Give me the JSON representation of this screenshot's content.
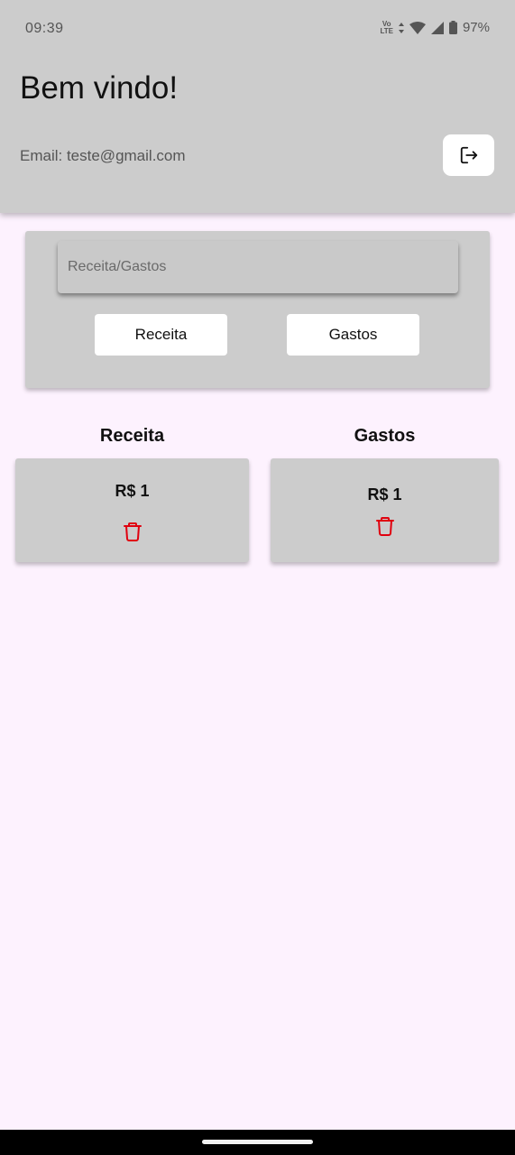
{
  "status_bar": {
    "time": "09:39",
    "volte_top": "Vo",
    "volte_bottom": "LTE",
    "battery": "97%"
  },
  "header": {
    "title": "Bem vindo!",
    "email": "Email: teste@gmail.com",
    "logout_icon": "logout-icon"
  },
  "form": {
    "placeholder": "Receita/Gastos",
    "value": "",
    "receita_button": "Receita",
    "gastos_button": "Gastos"
  },
  "columns": {
    "receita": {
      "title": "Receita",
      "entries": [
        {
          "amount": "R$ 1"
        }
      ]
    },
    "gastos": {
      "title": "Gastos",
      "entries": [
        {
          "amount": "R$ 1"
        }
      ]
    }
  },
  "colors": {
    "background": "#fdf2fe",
    "panel": "#cccccc",
    "delete": "#e0000f"
  }
}
